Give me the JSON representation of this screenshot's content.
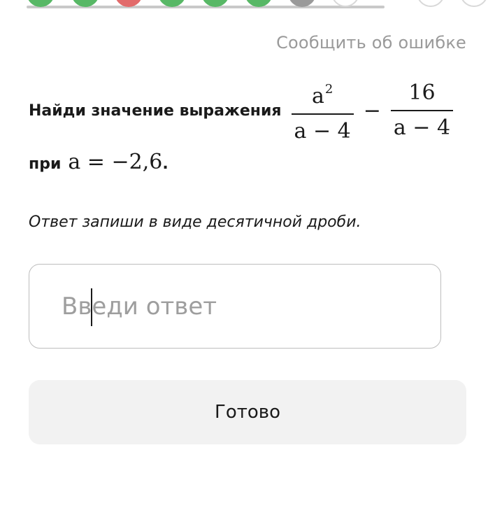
{
  "progress": {
    "dots": [
      {
        "state": "correct"
      },
      {
        "state": "correct"
      },
      {
        "state": "wrong"
      },
      {
        "state": "correct"
      },
      {
        "state": "correct"
      },
      {
        "state": "correct"
      },
      {
        "state": "current"
      },
      {
        "state": "empty"
      },
      {
        "state": "empty"
      },
      {
        "state": "empty"
      }
    ]
  },
  "report_link": "Сообщить об ошибке",
  "task": {
    "prompt": "Найди значение выражения",
    "frac1_num_base": "a",
    "frac1_num_exp": "2",
    "frac1_den": "a − 4",
    "operator": "−",
    "frac2_num": "16",
    "frac2_den": "a − 4",
    "condition_label": "при",
    "condition_math": "a = −2,6",
    "period": "."
  },
  "hint": "Ответ запиши в виде десятичной дроби.",
  "answer": {
    "value": "",
    "placeholder": "Введи ответ"
  },
  "submit_label": "Готово",
  "colors": {
    "correct": "#58b866",
    "wrong": "#e26b6b",
    "current": "#9a9a9a",
    "link": "#9a9a9a",
    "button_bg": "#f2f2f2"
  }
}
